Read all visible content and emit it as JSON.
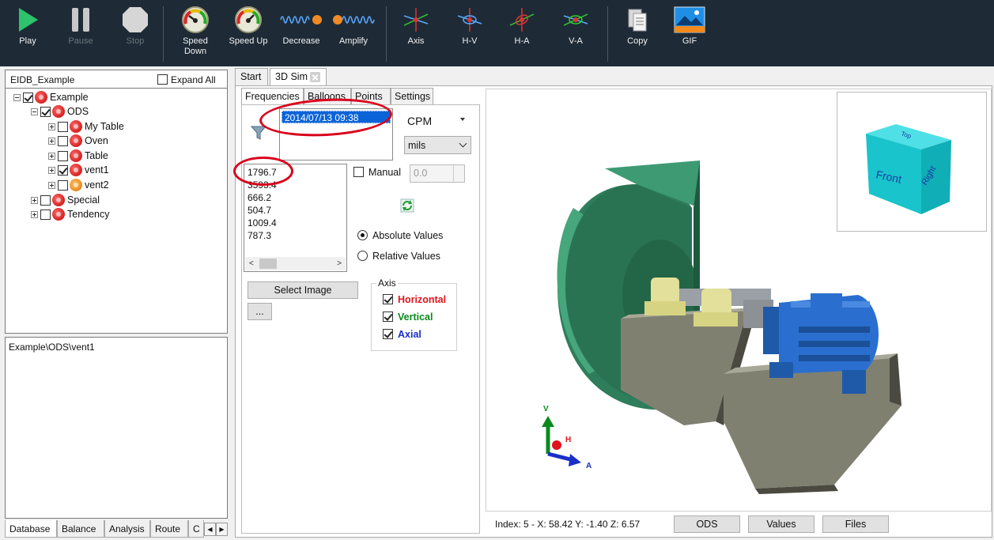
{
  "toolbar": {
    "play": "Play",
    "pause": "Pause",
    "stop": "Stop",
    "speed_down": "Speed Down",
    "speed_up": "Speed Up",
    "decrease": "Decrease",
    "amplify": "Amplify",
    "axis": "Axis",
    "hv": "H-V",
    "ha": "H-A",
    "va": "V-A",
    "copy": "Copy",
    "gif": "GIF"
  },
  "tree": {
    "header_title": "EIDB_Example",
    "expand_all": "Expand All",
    "nodes": [
      {
        "label": "Example"
      },
      {
        "label": "ODS"
      },
      {
        "label": "My Table"
      },
      {
        "label": "Oven"
      },
      {
        "label": "Table"
      },
      {
        "label": "vent1"
      },
      {
        "label": "vent2"
      },
      {
        "label": "Special"
      },
      {
        "label": "Tendency"
      }
    ]
  },
  "path": "Example\\ODS\\vent1",
  "bottom_tabs": [
    "Database",
    "Balance",
    "Analysis",
    "Route",
    "C"
  ],
  "main_tabs": [
    "Start",
    "3D Sim"
  ],
  "inner_tabs": [
    "Frequencies",
    "Balloons",
    "Points",
    "Settings"
  ],
  "dates": [
    "2014/07/13 09:38"
  ],
  "unit": "CPM",
  "amplitude_unit": "mils",
  "frequencies": [
    "1796.7",
    "3593.4",
    "666.2",
    "504.7",
    "1009.4",
    "787.3"
  ],
  "manual": {
    "label": "Manual",
    "value": "0.0"
  },
  "values_mode": {
    "absolute": "Absolute Values",
    "relative": "Relative Values"
  },
  "select_image": "Select Image",
  "dots": "...",
  "axis_group": {
    "title": "Axis",
    "horizontal": "Horizontal",
    "vertical": "Vertical",
    "axial": "Axial"
  },
  "colors": {
    "horizontal": "#e0141e",
    "vertical": "#0a8a1e",
    "axial": "#1a2ec8"
  },
  "view": {
    "cube_front": "Front",
    "cube_right": "Right",
    "cube_top": "Top",
    "triad_v": "V",
    "triad_h": "H",
    "triad_a": "A"
  },
  "status": "Index: 5 - X: 58.42 Y: -1.40 Z: 6.57",
  "buttons": {
    "ods": "ODS",
    "values": "Values",
    "files": "Files"
  }
}
